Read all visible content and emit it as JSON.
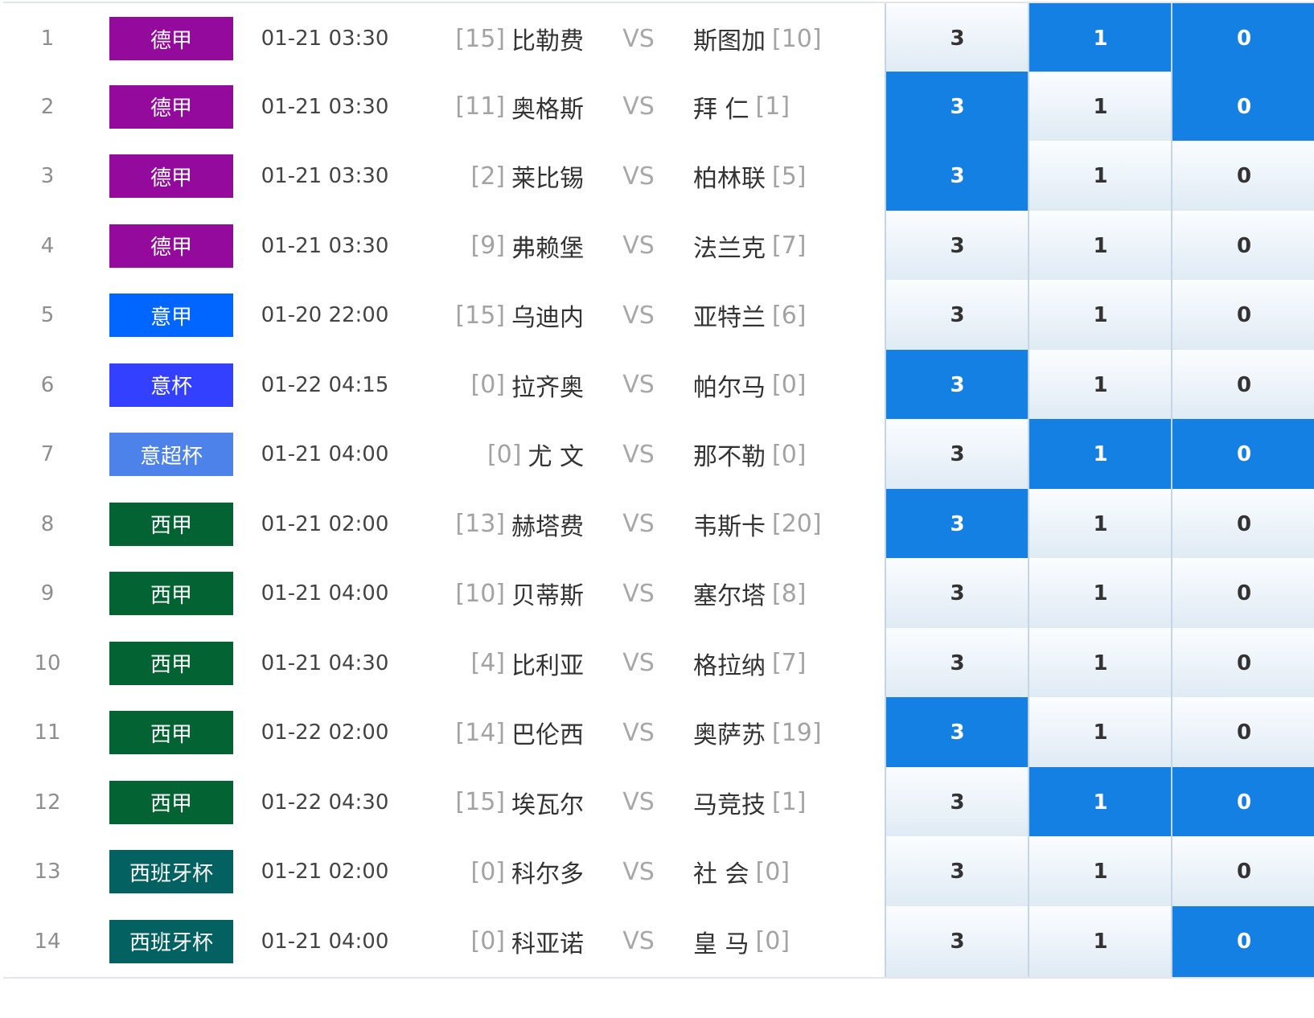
{
  "colors": {
    "德甲": "#930a9d",
    "意甲": "#0066ff",
    "意杯": "#3340ff",
    "意超杯": "#4d82ea",
    "西甲": "#046332",
    "西班牙杯": "#036261",
    "highlight": "#1480e3"
  },
  "vs_label": "VS",
  "odds_labels": [
    "3",
    "1",
    "0"
  ],
  "matches": [
    {
      "index": "1",
      "league": "德甲",
      "time": "01-21 03:30",
      "home_rank": "[15]",
      "home": "比勒费",
      "away": "斯图加",
      "away_rank": "[10]",
      "highlight": [
        false,
        true,
        true
      ]
    },
    {
      "index": "2",
      "league": "德甲",
      "time": "01-21 03:30",
      "home_rank": "[11]",
      "home": "奥格斯",
      "away": "拜 仁",
      "away_rank": "[1]",
      "highlight": [
        true,
        false,
        true
      ]
    },
    {
      "index": "3",
      "league": "德甲",
      "time": "01-21 03:30",
      "home_rank": "[2]",
      "home": "莱比锡",
      "away": "柏林联",
      "away_rank": "[5]",
      "highlight": [
        true,
        false,
        false
      ]
    },
    {
      "index": "4",
      "league": "德甲",
      "time": "01-21 03:30",
      "home_rank": "[9]",
      "home": "弗赖堡",
      "away": "法兰克",
      "away_rank": "[7]",
      "highlight": [
        false,
        false,
        false
      ]
    },
    {
      "index": "5",
      "league": "意甲",
      "time": "01-20 22:00",
      "home_rank": "[15]",
      "home": "乌迪内",
      "away": "亚特兰",
      "away_rank": "[6]",
      "highlight": [
        false,
        false,
        false
      ]
    },
    {
      "index": "6",
      "league": "意杯",
      "time": "01-22 04:15",
      "home_rank": "[0]",
      "home": "拉齐奥",
      "away": "帕尔马",
      "away_rank": "[0]",
      "highlight": [
        true,
        false,
        false
      ]
    },
    {
      "index": "7",
      "league": "意超杯",
      "time": "01-21 04:00",
      "home_rank": "[0]",
      "home": "尤 文",
      "away": "那不勒",
      "away_rank": "[0]",
      "highlight": [
        false,
        true,
        true
      ]
    },
    {
      "index": "8",
      "league": "西甲",
      "time": "01-21 02:00",
      "home_rank": "[13]",
      "home": "赫塔费",
      "away": "韦斯卡",
      "away_rank": "[20]",
      "highlight": [
        true,
        false,
        false
      ]
    },
    {
      "index": "9",
      "league": "西甲",
      "time": "01-21 04:00",
      "home_rank": "[10]",
      "home": "贝蒂斯",
      "away": "塞尔塔",
      "away_rank": "[8]",
      "highlight": [
        false,
        false,
        false
      ]
    },
    {
      "index": "10",
      "league": "西甲",
      "time": "01-21 04:30",
      "home_rank": "[4]",
      "home": "比利亚",
      "away": "格拉纳",
      "away_rank": "[7]",
      "highlight": [
        false,
        false,
        false
      ]
    },
    {
      "index": "11",
      "league": "西甲",
      "time": "01-22 02:00",
      "home_rank": "[14]",
      "home": "巴伦西",
      "away": "奥萨苏",
      "away_rank": "[19]",
      "highlight": [
        true,
        false,
        false
      ]
    },
    {
      "index": "12",
      "league": "西甲",
      "time": "01-22 04:30",
      "home_rank": "[15]",
      "home": "埃瓦尔",
      "away": "马竞技",
      "away_rank": "[1]",
      "highlight": [
        false,
        true,
        true
      ]
    },
    {
      "index": "13",
      "league": "西班牙杯",
      "time": "01-21 02:00",
      "home_rank": "[0]",
      "home": "科尔多",
      "away": "社 会",
      "away_rank": "[0]",
      "highlight": [
        false,
        false,
        false
      ]
    },
    {
      "index": "14",
      "league": "西班牙杯",
      "time": "01-21 04:00",
      "home_rank": "[0]",
      "home": "科亚诺",
      "away": "皇 马",
      "away_rank": "[0]",
      "highlight": [
        false,
        false,
        true
      ]
    }
  ]
}
